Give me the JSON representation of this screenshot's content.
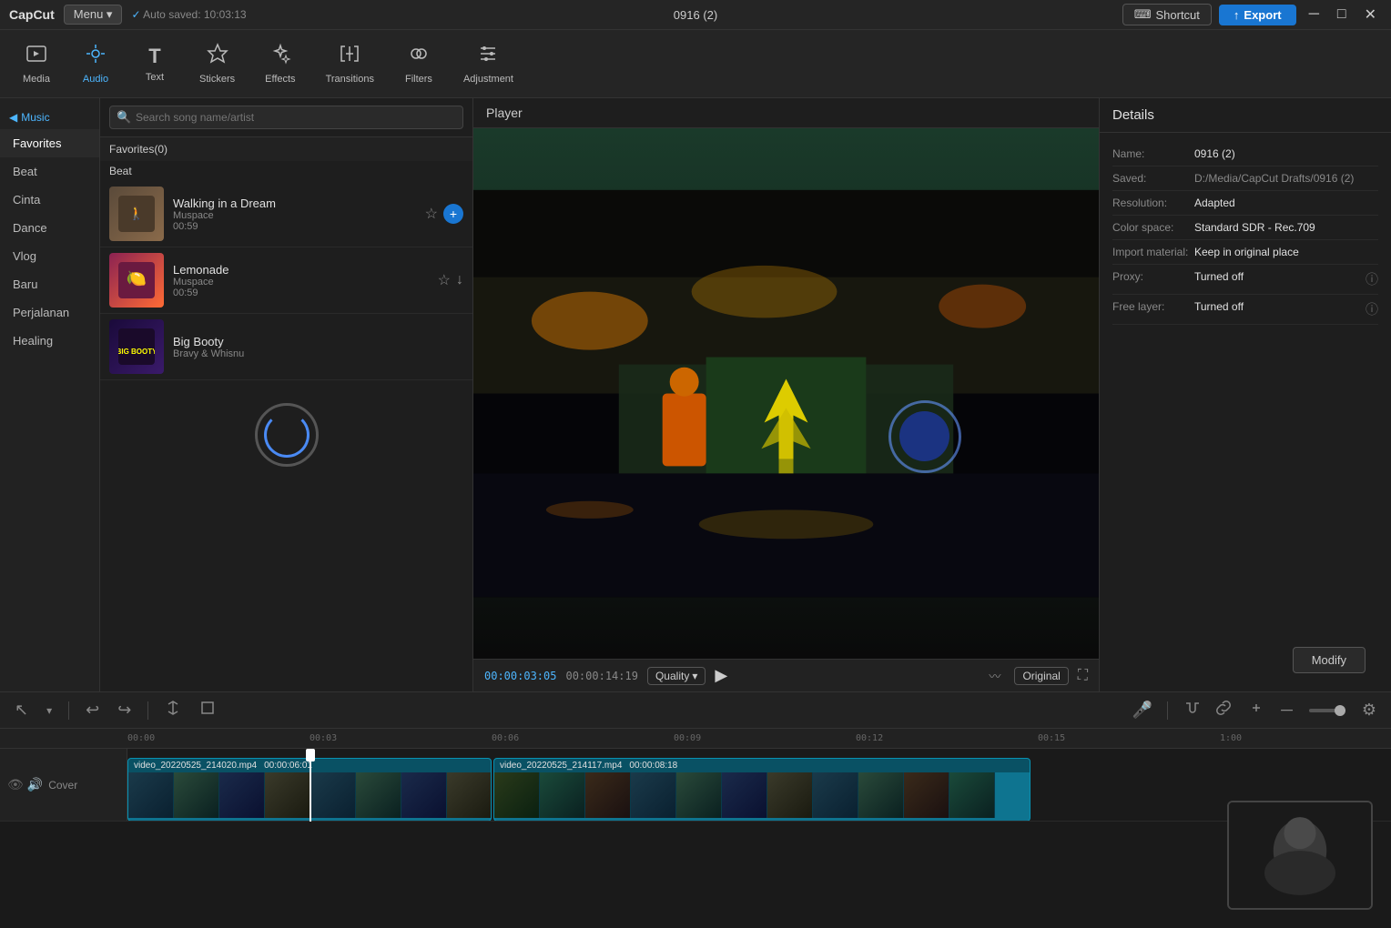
{
  "titlebar": {
    "logo": "CapCut",
    "menu_label": "Menu ▾",
    "autosave": "Auto saved: 10:03:13",
    "title": "0916 (2)",
    "shortcut_label": "Shortcut",
    "export_label": "Export",
    "window_minimize": "─",
    "window_maximize": "□",
    "window_close": "✕"
  },
  "toolbar": {
    "items": [
      {
        "id": "media",
        "icon": "⬛",
        "label": "Media"
      },
      {
        "id": "audio",
        "icon": "🎵",
        "label": "Audio",
        "active": true
      },
      {
        "id": "text",
        "icon": "T",
        "label": "Text"
      },
      {
        "id": "stickers",
        "icon": "⭐",
        "label": "Stickers"
      },
      {
        "id": "effects",
        "icon": "✨",
        "label": "Effects"
      },
      {
        "id": "transitions",
        "icon": "⇌",
        "label": "Transitions"
      },
      {
        "id": "filters",
        "icon": "🎨",
        "label": "Filters"
      },
      {
        "id": "adjustment",
        "icon": "⚙",
        "label": "Adjustment"
      }
    ]
  },
  "music_sidebar": {
    "section_header": "Music",
    "items": [
      "Favorites",
      "Beat",
      "Cinta",
      "Dance",
      "Vlog",
      "Baru",
      "Perjalanan",
      "Healing"
    ]
  },
  "music_content": {
    "search_placeholder": "Search song name/artist",
    "favorites_label": "Favorites(0)",
    "beat_label": "Beat",
    "songs": [
      {
        "title": "Walking in a Dream",
        "artist": "Muspace",
        "duration": "00:59",
        "thumb_color": "#5a4a3a"
      },
      {
        "title": "Lemonade",
        "artist": "Muspace",
        "duration": "00:59",
        "thumb_color": "#8b2252"
      },
      {
        "title": "Big Booty",
        "artist": "Bravy & Whisnu",
        "duration": "",
        "thumb_color": "#2a1a3a"
      }
    ]
  },
  "player": {
    "header": "Player",
    "current_time": "00:00:03:05",
    "total_time": "00:00:14:19",
    "quality_label": "Quality",
    "original_label": "Original"
  },
  "details": {
    "header": "Details",
    "fields": [
      {
        "label": "Name:",
        "value": "0916 (2)"
      },
      {
        "label": "Saved:",
        "value": "D:/Media/CapCut Drafts/0916 (2)"
      },
      {
        "label": "Resolution:",
        "value": "Adapted"
      },
      {
        "label": "Color space:",
        "value": "Standard SDR - Rec.709"
      },
      {
        "label": "Import material:",
        "value": "Keep in original place"
      },
      {
        "label": "Proxy:",
        "value": "Turned off"
      },
      {
        "label": "Free layer:",
        "value": "Turned off"
      }
    ],
    "modify_label": "Modify"
  },
  "timeline": {
    "ruler_marks": [
      "00:00",
      "00:03",
      "00:06",
      "00:09",
      "00:12",
      "00:15",
      "1:00"
    ],
    "track_label": "Cover",
    "clips": [
      {
        "filename": "video_20220525_214020.mp4",
        "duration": "00:00:06:01"
      },
      {
        "filename": "video_20220525_214117.mp4",
        "duration": "00:00:08:18"
      }
    ]
  },
  "icons": {
    "search": "🔍",
    "star": "☆",
    "star_filled": "★",
    "add": "+",
    "play": "▶",
    "undo": "↩",
    "redo": "↪",
    "split": "⚡",
    "mic": "🎤",
    "zoom_in": "+",
    "zoom_out": "-",
    "eye": "👁",
    "lock": "🔒",
    "settings": "⚙"
  }
}
